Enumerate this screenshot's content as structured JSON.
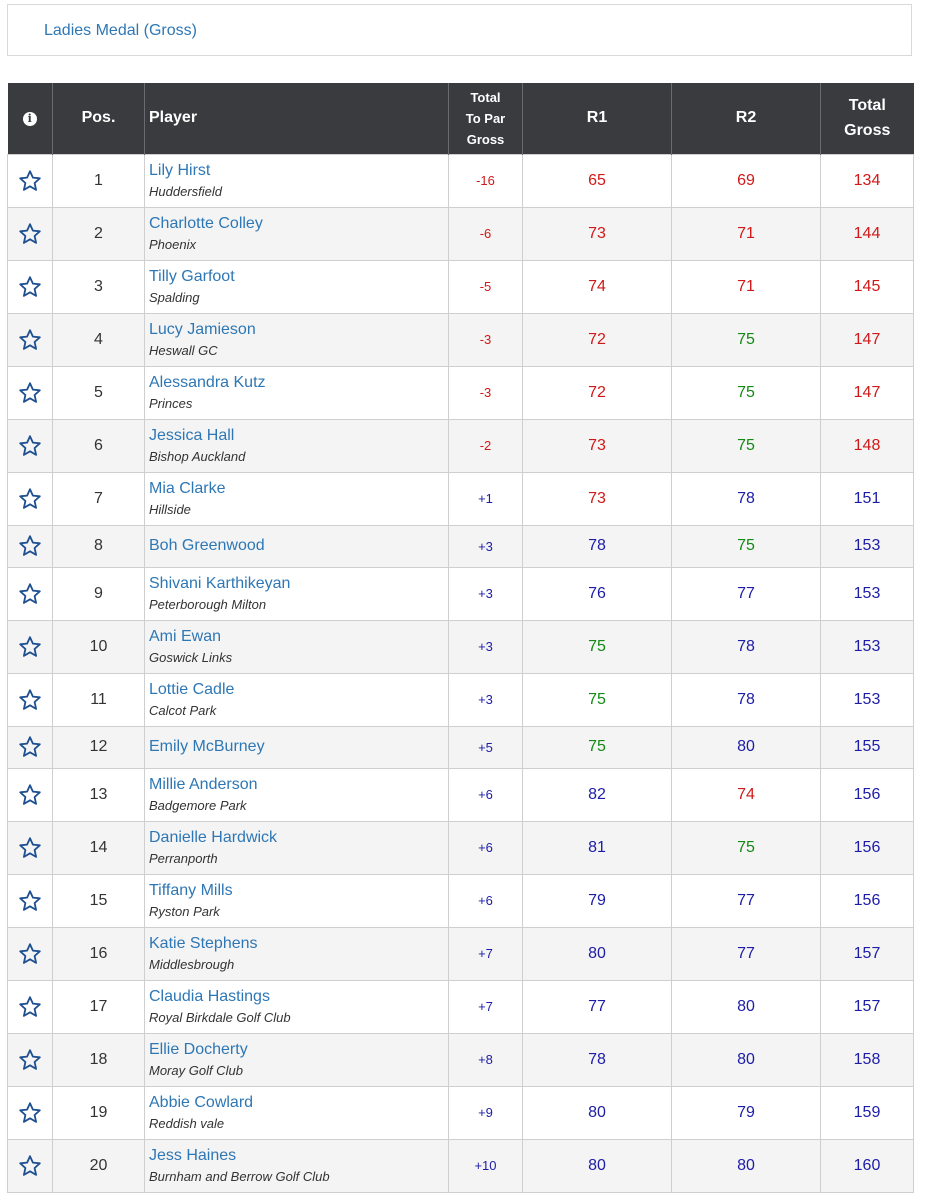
{
  "tab": {
    "label": "Ladies Medal (Gross)"
  },
  "colors": {
    "under": "#d11818",
    "over": "#1c1ca8",
    "par": "#138a13",
    "header_bg": "#3a3b3f",
    "link": "#2e77b5"
  },
  "headers": {
    "info_icon": "info-icon",
    "pos": "Pos.",
    "player": "Player",
    "topar_line1": "Total",
    "topar_line2": "To Par",
    "topar_line3": "Gross",
    "r1": "R1",
    "r2": "R2",
    "total_line1": "Total",
    "total_line2": "Gross"
  },
  "rows": [
    {
      "pos": "1",
      "name": "Lily Hirst",
      "club": "Huddersfield",
      "topar": "-16",
      "r1": "65",
      "r2": "69",
      "total": "134",
      "c_topar": "red",
      "c_r1": "red",
      "c_r2": "red",
      "c_total": "red"
    },
    {
      "pos": "2",
      "name": "Charlotte Colley",
      "club": "Phoenix",
      "topar": "-6",
      "r1": "73",
      "r2": "71",
      "total": "144",
      "c_topar": "red",
      "c_r1": "red",
      "c_r2": "red",
      "c_total": "red"
    },
    {
      "pos": "3",
      "name": "Tilly Garfoot",
      "club": "Spalding",
      "topar": "-5",
      "r1": "74",
      "r2": "71",
      "total": "145",
      "c_topar": "red",
      "c_r1": "red",
      "c_r2": "red",
      "c_total": "red"
    },
    {
      "pos": "4",
      "name": "Lucy Jamieson",
      "club": "Heswall GC",
      "topar": "-3",
      "r1": "72",
      "r2": "75",
      "total": "147",
      "c_topar": "red",
      "c_r1": "red",
      "c_r2": "green",
      "c_total": "red"
    },
    {
      "pos": "5",
      "name": "Alessandra Kutz",
      "club": "Princes",
      "topar": "-3",
      "r1": "72",
      "r2": "75",
      "total": "147",
      "c_topar": "red",
      "c_r1": "red",
      "c_r2": "green",
      "c_total": "red"
    },
    {
      "pos": "6",
      "name": "Jessica Hall",
      "club": "Bishop Auckland",
      "topar": "-2",
      "r1": "73",
      "r2": "75",
      "total": "148",
      "c_topar": "red",
      "c_r1": "red",
      "c_r2": "green",
      "c_total": "red"
    },
    {
      "pos": "7",
      "name": "Mia Clarke",
      "club": "Hillside",
      "topar": "+1",
      "r1": "73",
      "r2": "78",
      "total": "151",
      "c_topar": "blue",
      "c_r1": "red",
      "c_r2": "blue",
      "c_total": "blue"
    },
    {
      "pos": "8",
      "name": "Boh Greenwood",
      "club": "",
      "topar": "+3",
      "r1": "78",
      "r2": "75",
      "total": "153",
      "c_topar": "blue",
      "c_r1": "blue",
      "c_r2": "green",
      "c_total": "blue"
    },
    {
      "pos": "9",
      "name": "Shivani Karthikeyan",
      "club": "Peterborough Milton",
      "topar": "+3",
      "r1": "76",
      "r2": "77",
      "total": "153",
      "c_topar": "blue",
      "c_r1": "blue",
      "c_r2": "blue",
      "c_total": "blue"
    },
    {
      "pos": "10",
      "name": "Ami Ewan",
      "club": "Goswick Links",
      "topar": "+3",
      "r1": "75",
      "r2": "78",
      "total": "153",
      "c_topar": "blue",
      "c_r1": "green",
      "c_r2": "blue",
      "c_total": "blue"
    },
    {
      "pos": "11",
      "name": "Lottie Cadle",
      "club": "Calcot Park",
      "topar": "+3",
      "r1": "75",
      "r2": "78",
      "total": "153",
      "c_topar": "blue",
      "c_r1": "green",
      "c_r2": "blue",
      "c_total": "blue"
    },
    {
      "pos": "12",
      "name": "Emily McBurney",
      "club": "",
      "topar": "+5",
      "r1": "75",
      "r2": "80",
      "total": "155",
      "c_topar": "blue",
      "c_r1": "green",
      "c_r2": "blue",
      "c_total": "blue"
    },
    {
      "pos": "13",
      "name": "Millie Anderson",
      "club": "Badgemore Park",
      "topar": "+6",
      "r1": "82",
      "r2": "74",
      "total": "156",
      "c_topar": "blue",
      "c_r1": "blue",
      "c_r2": "red",
      "c_total": "blue"
    },
    {
      "pos": "14",
      "name": "Danielle Hardwick",
      "club": "Perranporth",
      "topar": "+6",
      "r1": "81",
      "r2": "75",
      "total": "156",
      "c_topar": "blue",
      "c_r1": "blue",
      "c_r2": "green",
      "c_total": "blue"
    },
    {
      "pos": "15",
      "name": "Tiffany Mills",
      "club": "Ryston Park",
      "topar": "+6",
      "r1": "79",
      "r2": "77",
      "total": "156",
      "c_topar": "blue",
      "c_r1": "blue",
      "c_r2": "blue",
      "c_total": "blue"
    },
    {
      "pos": "16",
      "name": "Katie Stephens",
      "club": "Middlesbrough",
      "topar": "+7",
      "r1": "80",
      "r2": "77",
      "total": "157",
      "c_topar": "blue",
      "c_r1": "blue",
      "c_r2": "blue",
      "c_total": "blue"
    },
    {
      "pos": "17",
      "name": "Claudia Hastings",
      "club": "Royal Birkdale Golf Club",
      "topar": "+7",
      "r1": "77",
      "r2": "80",
      "total": "157",
      "c_topar": "blue",
      "c_r1": "blue",
      "c_r2": "blue",
      "c_total": "blue"
    },
    {
      "pos": "18",
      "name": "Ellie Docherty",
      "club": "Moray Golf Club",
      "topar": "+8",
      "r1": "78",
      "r2": "80",
      "total": "158",
      "c_topar": "blue",
      "c_r1": "blue",
      "c_r2": "blue",
      "c_total": "blue"
    },
    {
      "pos": "19",
      "name": "Abbie Cowlard",
      "club": "Reddish vale",
      "topar": "+9",
      "r1": "80",
      "r2": "79",
      "total": "159",
      "c_topar": "blue",
      "c_r1": "blue",
      "c_r2": "blue",
      "c_total": "blue"
    },
    {
      "pos": "20",
      "name": "Jess Haines",
      "club": "Burnham and Berrow Golf Club",
      "topar": "+10",
      "r1": "80",
      "r2": "80",
      "total": "160",
      "c_topar": "blue",
      "c_r1": "blue",
      "c_r2": "blue",
      "c_total": "blue"
    }
  ]
}
